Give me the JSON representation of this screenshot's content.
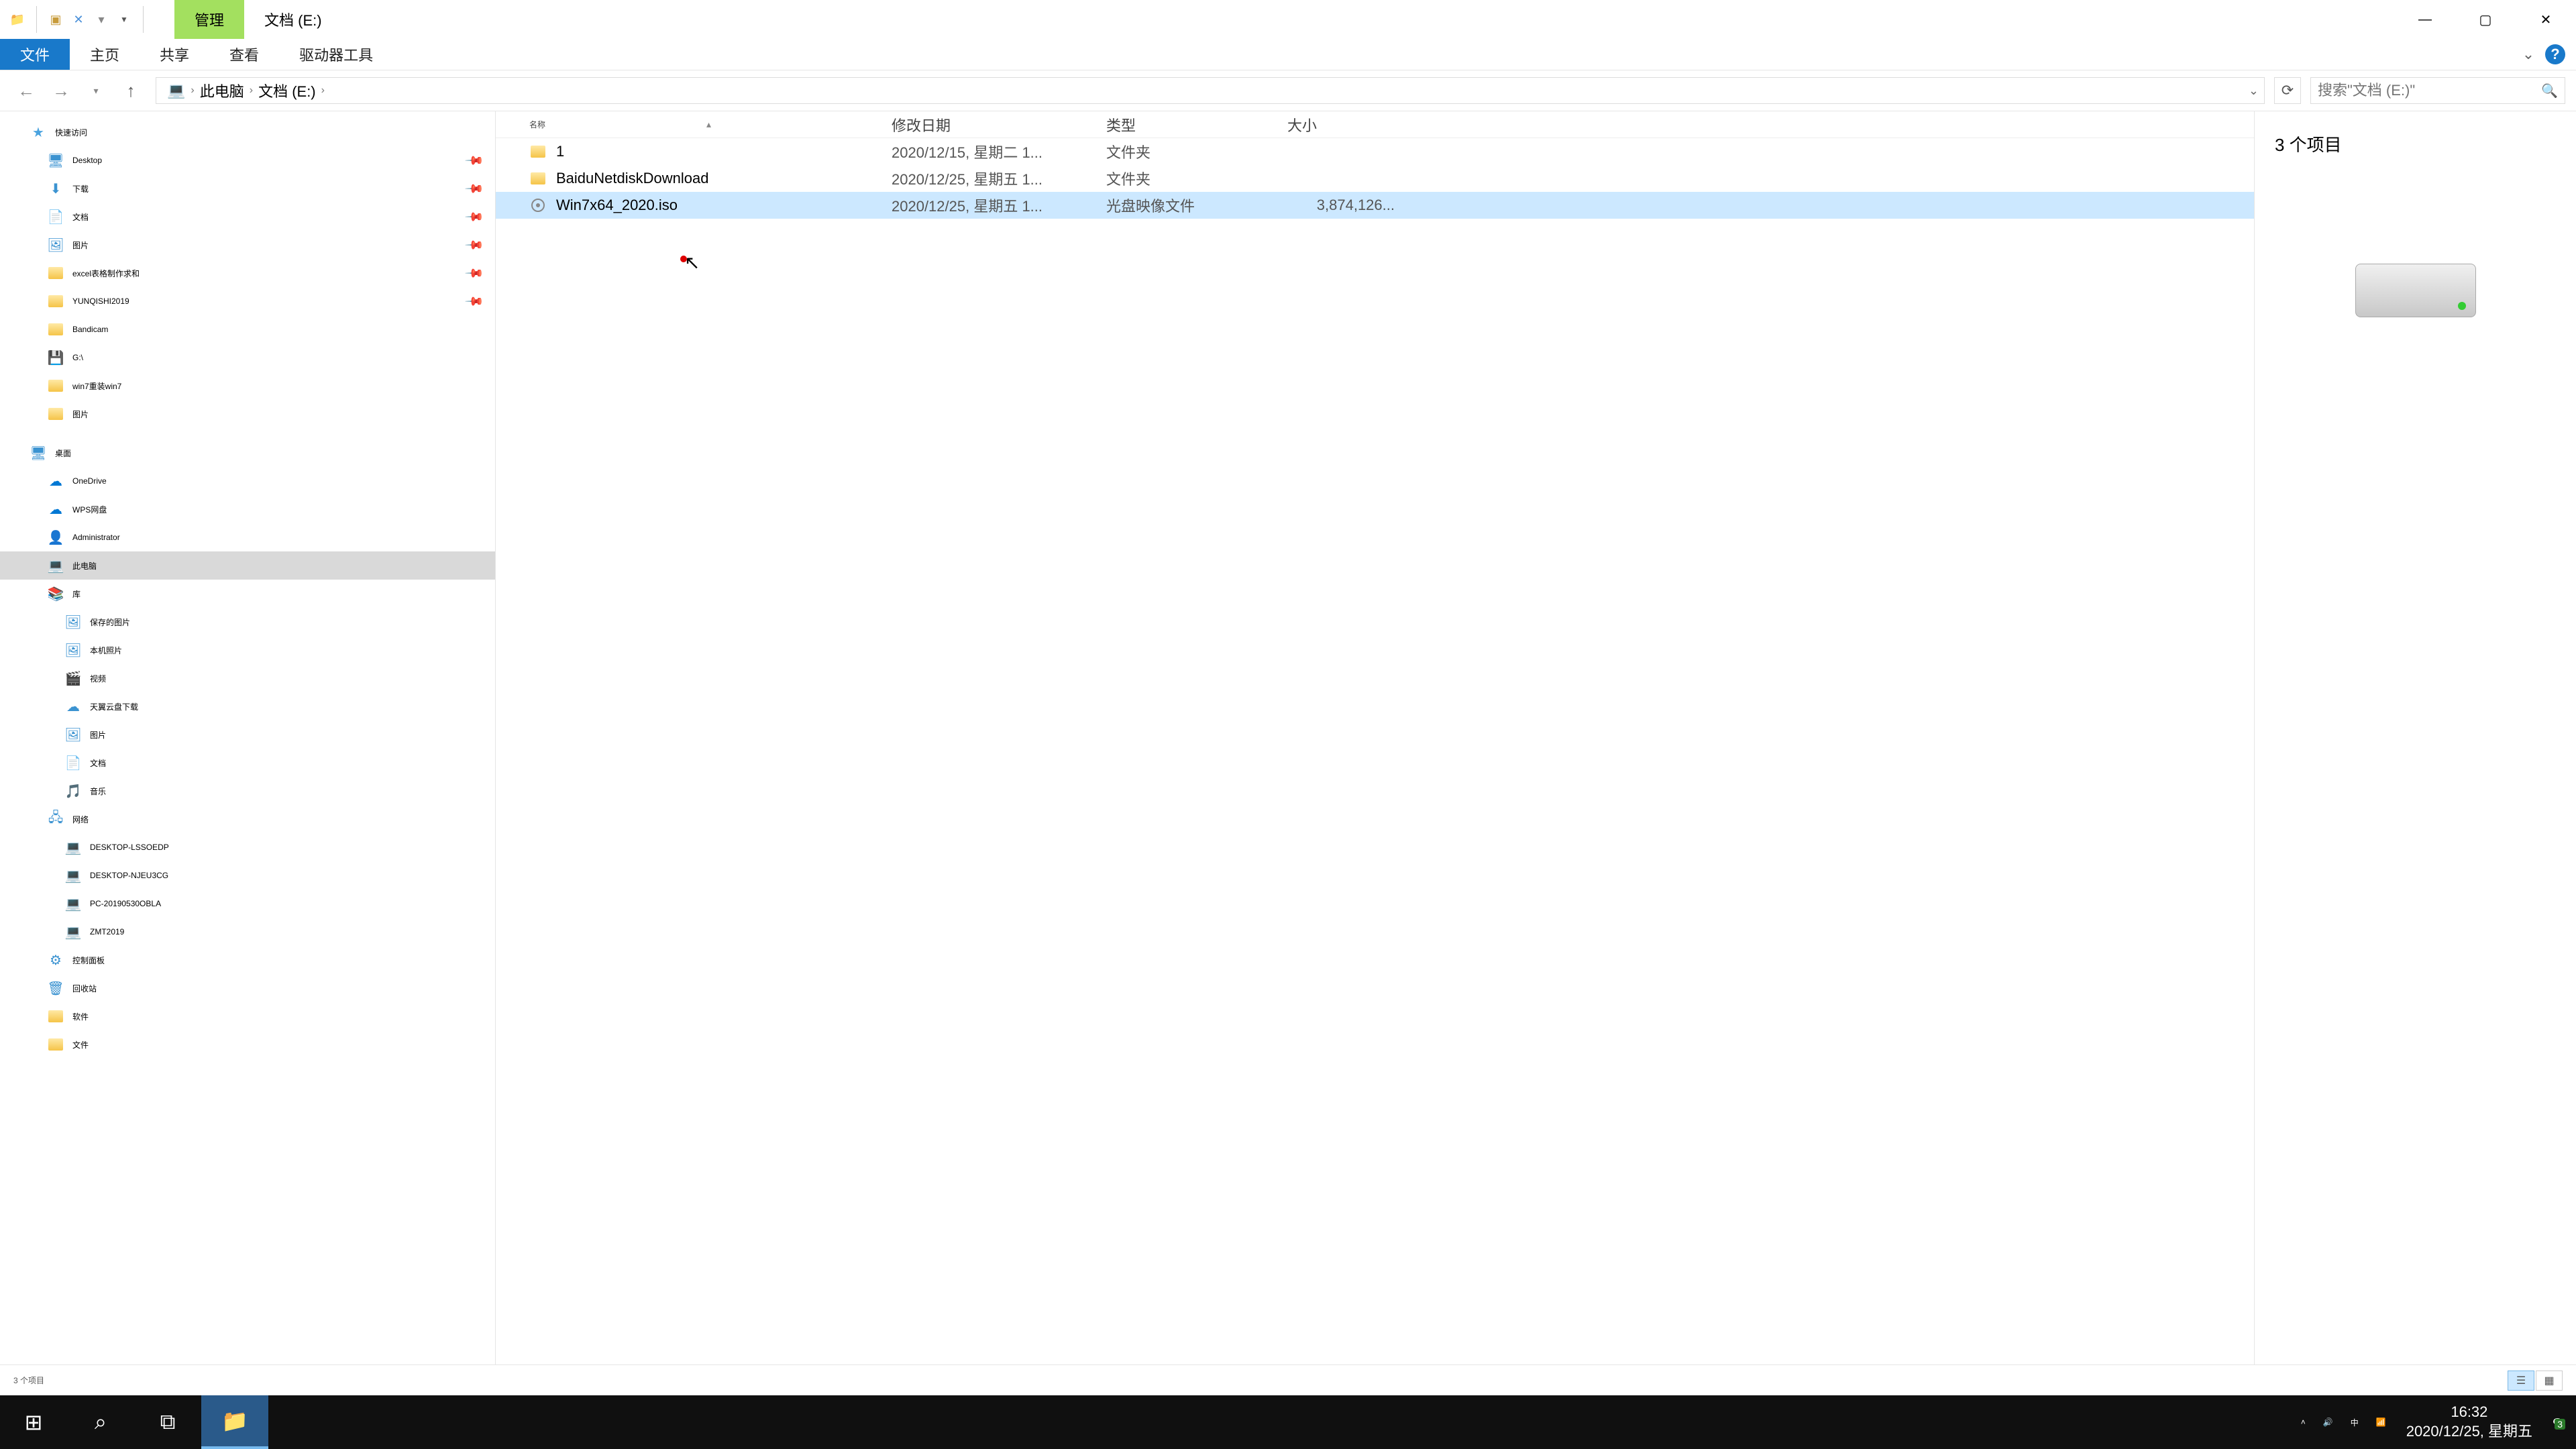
{
  "titlebar": {
    "contextual_tab": "管理",
    "drive_label": "文档 (E:)"
  },
  "ribbon": {
    "file": "文件",
    "home": "主页",
    "share": "共享",
    "view": "查看",
    "drive_tools": "驱动器工具"
  },
  "breadcrumb": {
    "pc": "此电脑",
    "drive": "文档 (E:)"
  },
  "search": {
    "placeholder": "搜索\"文档 (E:)\""
  },
  "tree": {
    "quick": "快速访问",
    "desktop": "Desktop",
    "downloads": "下载",
    "documents": "文档",
    "pictures": "图片",
    "excel": "excel表格制作求和",
    "yunqishi": "YUNQISHI2019",
    "bandicam": "Bandicam",
    "gdrive": "G:\\",
    "win7": "win7重装win7",
    "pictures2": "图片",
    "desktop_root": "桌面",
    "onedrive": "OneDrive",
    "wps": "WPS网盘",
    "admin": "Administrator",
    "thispc": "此电脑",
    "library": "库",
    "saved_pics": "保存的图片",
    "local_photos": "本机照片",
    "videos": "视频",
    "tianyi": "天翼云盘下载",
    "lib_pics": "图片",
    "lib_docs": "文档",
    "music": "音乐",
    "network": "网络",
    "pc1": "DESKTOP-LSSOEDP",
    "pc2": "DESKTOP-NJEU3CG",
    "pc3": "PC-20190530OBLA",
    "pc4": "ZMT2019",
    "control": "控制面板",
    "recycle": "回收站",
    "software": "软件",
    "files": "文件"
  },
  "columns": {
    "name": "名称",
    "date": "修改日期",
    "type": "类型",
    "size": "大小"
  },
  "files": [
    {
      "name": "1",
      "date": "2020/12/15, 星期二 1...",
      "type": "文件夹",
      "size": "",
      "icon": "folder"
    },
    {
      "name": "BaiduNetdiskDownload",
      "date": "2020/12/25, 星期五 1...",
      "type": "文件夹",
      "size": "",
      "icon": "folder"
    },
    {
      "name": "Win7x64_2020.iso",
      "date": "2020/12/25, 星期五 1...",
      "type": "光盘映像文件",
      "size": "3,874,126...",
      "icon": "disc",
      "selected": true
    }
  ],
  "preview": {
    "count": "3 个项目"
  },
  "status": {
    "text": "3 个项目"
  },
  "clock": {
    "time": "16:32",
    "date": "2020/12/25, 星期五"
  },
  "tray": {
    "ime": "中",
    "badge": "3"
  }
}
